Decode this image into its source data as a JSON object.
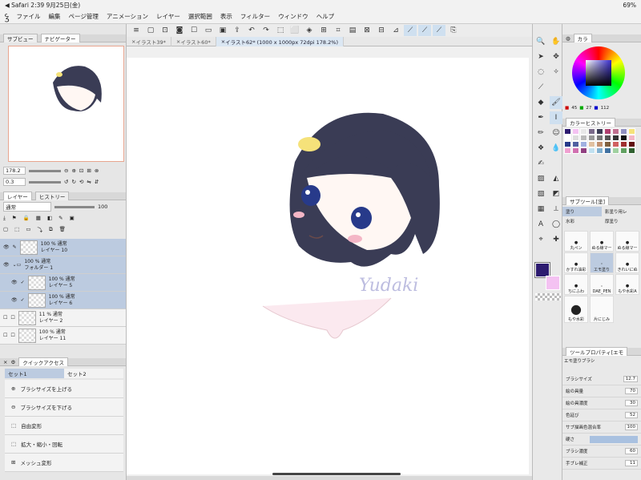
{
  "status": {
    "left": "◀ Safari  2:39  9月25日(金)",
    "right": "69%"
  },
  "menu": [
    "ファイル",
    "編集",
    "ページ管理",
    "アニメーション",
    "レイヤー",
    "選択範囲",
    "表示",
    "フィルター",
    "ウィンドウ",
    "ヘルプ"
  ],
  "tabs": [
    {
      "label": "イラスト39*"
    },
    {
      "label": "イラスト60*"
    },
    {
      "label": "イラスト62* (1000 x 1000px 72dpi 178.2%)"
    }
  ],
  "left": {
    "nav_tabs": [
      "サブビュー",
      "ナビゲーター"
    ],
    "zoom": "178.2",
    "angle": "0.3",
    "layer_tabs": [
      "レイヤー",
      "ヒストリー"
    ],
    "blend_mode": "通常",
    "opacity": "100",
    "layers": [
      {
        "pct": "100 % 通常",
        "name": "レイヤー 10",
        "sel": true
      },
      {
        "pct": "100 % 通常",
        "name": "フォルダー 1",
        "sel": true
      },
      {
        "pct": "100 % 通常",
        "name": "レイヤー 5",
        "sel": true
      },
      {
        "pct": "100 % 通常",
        "name": "レイヤー 6",
        "sel": true
      },
      {
        "pct": "11 % 通常",
        "name": "レイヤー 2",
        "sel": false
      },
      {
        "pct": "100 % 通常",
        "name": "レイヤー 11",
        "sel": false
      }
    ],
    "qa_title": "クイックアクセス",
    "sets": [
      "セット1",
      "セット2"
    ],
    "qa_items": [
      "ブラシサイズを上げる",
      "ブラシサイズを下げる",
      "自由変形",
      "拡大・縮小・回転",
      "メッシュ変形"
    ]
  },
  "canvas": {
    "signature": "Yudaki"
  },
  "right": {
    "color_tab": "カラ",
    "rgb": [
      "45",
      "27",
      "112"
    ],
    "history_tab": "カラーヒストリー",
    "subtool_tab": "サブツール[塗]",
    "subtools": [
      "塗り",
      "影塗り用レ",
      "水彩",
      "厚塗り"
    ],
    "brushes": [
      "丸ペン",
      "ぬる線マー",
      "ぬる線マー",
      "かすれ油彩",
      "エモ塗り",
      "きれいにぬ",
      "ちにふわ",
      "DAE_PEN",
      "もや水彩A",
      "もや水彩",
      "片にじみ"
    ],
    "prop_tab": "ツールプロパティ[エモ",
    "brush_name": "エモ塗りブラシ",
    "props": [
      {
        "label": "ブラシサイズ",
        "val": "12.7"
      },
      {
        "label": "絵の具量",
        "val": "70"
      },
      {
        "label": "絵の具濃度",
        "val": "30"
      },
      {
        "label": "色延び",
        "val": "52"
      },
      {
        "label": "サブ描画色混合率",
        "val": "100"
      },
      {
        "label": "硬さ",
        "val": ""
      },
      {
        "label": "ブラシ濃度",
        "val": "60"
      },
      {
        "label": "手ブレ補正",
        "val": "11"
      }
    ]
  },
  "colors": {
    "main": "#2d1b70",
    "sub": "#f4c2f2",
    "accent": "#4a7fc0"
  }
}
